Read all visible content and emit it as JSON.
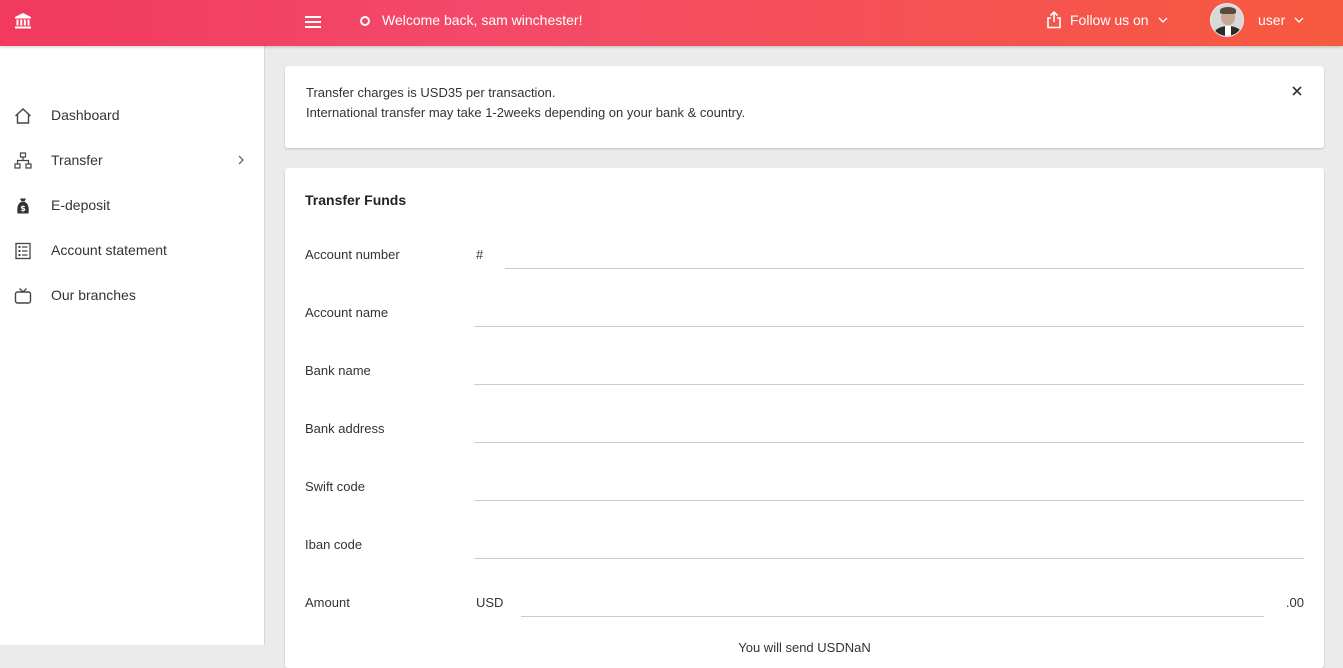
{
  "topbar": {
    "welcome": "Welcome back, sam winchester!",
    "follow_label": "Follow us on",
    "user_label": "user"
  },
  "sidebar": {
    "items": [
      {
        "label": "Dashboard",
        "icon": "home-icon"
      },
      {
        "label": "Transfer",
        "icon": "sitemap-icon",
        "has_submenu": true
      },
      {
        "label": "E-deposit",
        "icon": "money-bag-icon"
      },
      {
        "label": "Account statement",
        "icon": "statement-icon"
      },
      {
        "label": "Our branches",
        "icon": "tv-icon"
      }
    ]
  },
  "notice": {
    "line1": "Transfer charges is USD35 per transaction.",
    "line2": "International transfer may take 1-2weeks depending on your bank & country."
  },
  "form": {
    "title": "Transfer Funds",
    "fields": {
      "account_number": {
        "label": "Account number",
        "prefix": "#",
        "value": ""
      },
      "account_name": {
        "label": "Account name",
        "value": ""
      },
      "bank_name": {
        "label": "Bank name",
        "value": ""
      },
      "bank_address": {
        "label": "Bank address",
        "value": ""
      },
      "swift_code": {
        "label": "Swift code",
        "value": ""
      },
      "iban_code": {
        "label": "Iban code",
        "value": ""
      },
      "amount": {
        "label": "Amount",
        "prefix": "USD",
        "suffix": ".00",
        "value": ""
      }
    },
    "hint": "You will send USDNaN"
  },
  "colors": {
    "accent_start": "#f13a5d",
    "accent_end": "#f65a3e"
  }
}
